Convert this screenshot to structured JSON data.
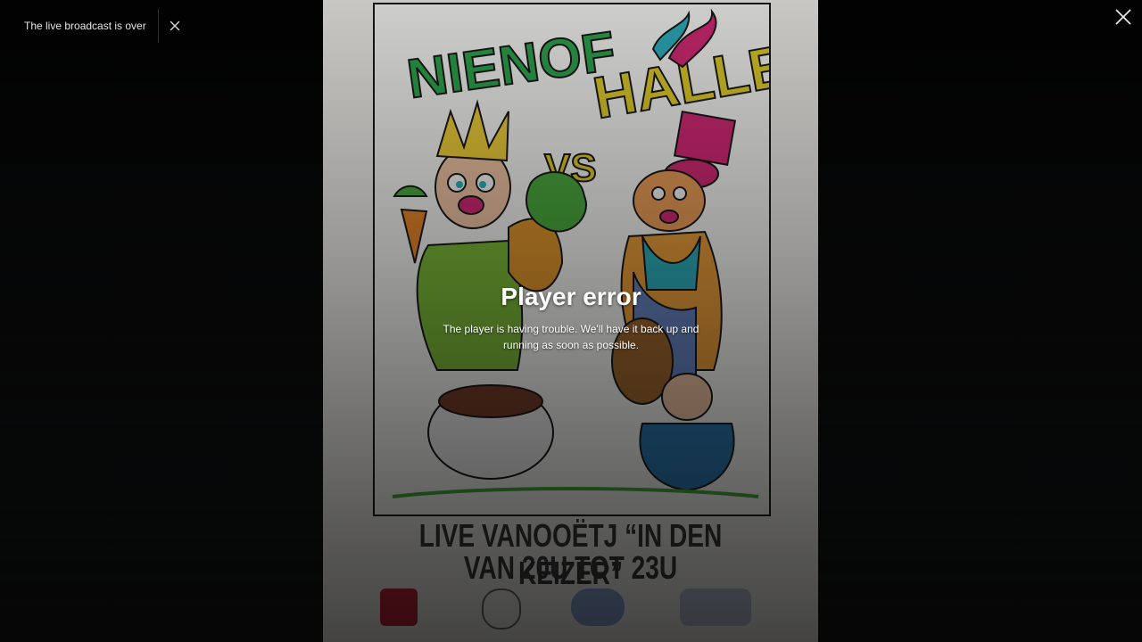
{
  "toast": {
    "message": "The live broadcast is over",
    "close_icon": "close-icon"
  },
  "player": {
    "close_icon": "close-icon",
    "error_title": "Player error",
    "error_message": "The player is having trouble. We'll have it back up and running as soon as possible."
  },
  "poster": {
    "line1": "LIVE VANOOËTJ “IN DEN KEIZER”",
    "line2": "VAN 20U TOT 23U",
    "title_art_left": "NIENOF",
    "title_art_right": "HALLE",
    "vs_text": "VS"
  },
  "colors": {
    "background": "#000000",
    "poster_bg": "#f4f3ef",
    "text_white": "#ffffff",
    "title_green": "#2fa84f",
    "title_yellow": "#e6d12a",
    "accent_pink": "#d82b78",
    "accent_teal": "#2fb3c2"
  }
}
